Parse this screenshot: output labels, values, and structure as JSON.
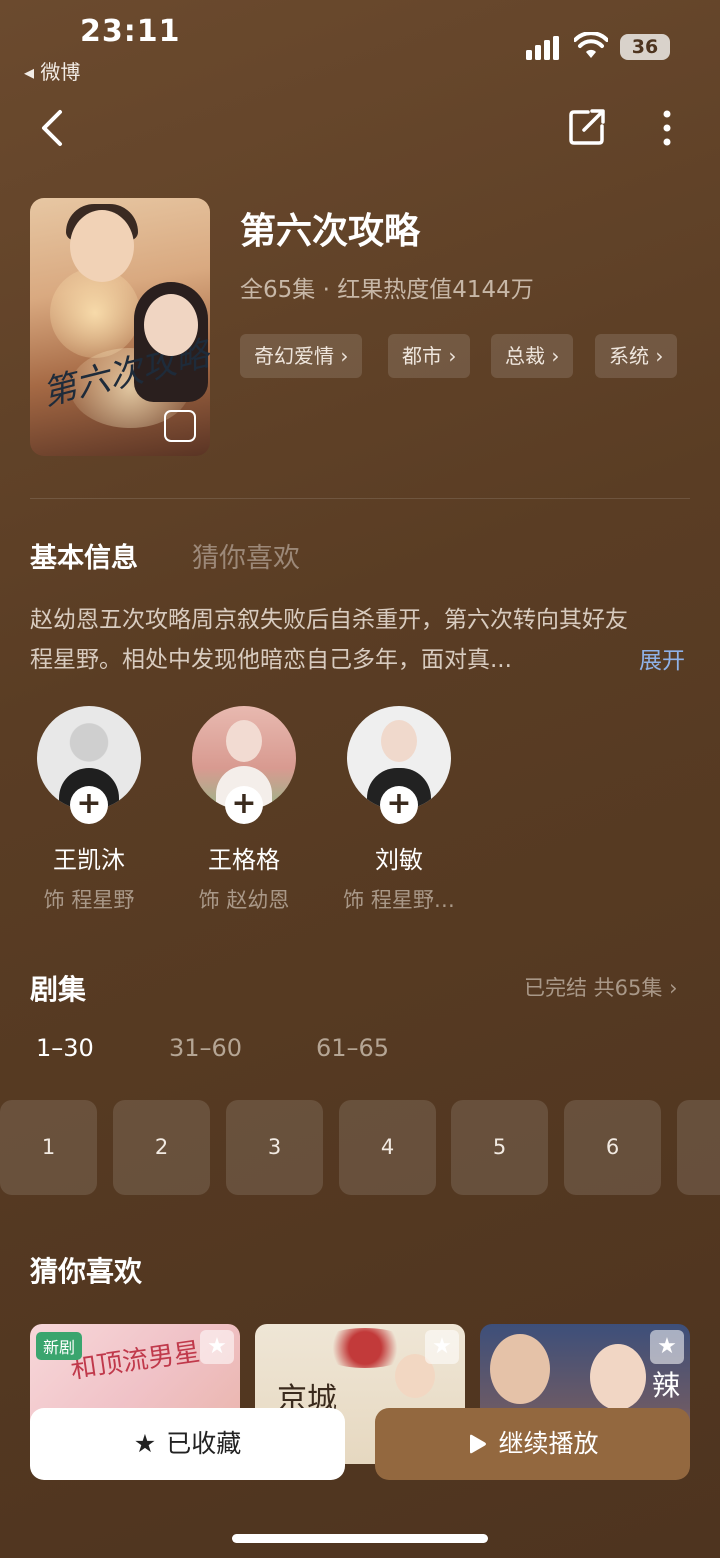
{
  "status": {
    "time": "23:11",
    "back_app": "◂ 微博",
    "battery": "36"
  },
  "show": {
    "title": "第六次攻略",
    "meta": "全65集 · 红果热度值4144万",
    "tags": [
      "奇幻爱情 ›",
      "都市 ›",
      "总裁 ›",
      "系统 ›"
    ],
    "poster_title_art": "第六次攻略"
  },
  "tabs": {
    "basic": "基本信息",
    "guess": "猜你喜欢"
  },
  "synopsis": {
    "text": "赵幼恩五次攻略周京叙失败后自杀重开，第六次转向其好友程星野。相处中发现他暗恋自己多年，面对真...",
    "expand": "展开"
  },
  "cast": [
    {
      "name": "王凯沐",
      "role": "饰 程星野"
    },
    {
      "name": "王格格",
      "role": "饰 赵幼恩"
    },
    {
      "name": "刘敏",
      "role": "饰 程星野…"
    }
  ],
  "episodes": {
    "title": "剧集",
    "status": "已完结 共65集 ›",
    "ranges": [
      "1–30",
      "31–60",
      "61–65"
    ],
    "items": [
      "1",
      "2",
      "3",
      "4",
      "5",
      "6"
    ]
  },
  "recommend": {
    "title": "猜你喜欢",
    "badge": "新剧",
    "card_art": [
      "和顶流男星",
      "京城",
      "辣"
    ]
  },
  "actions": {
    "favorite": "已收藏",
    "play": "继续播放"
  },
  "colors": {
    "accent": "#93683f",
    "background": "#5a3d24",
    "link": "#8fb2e8"
  }
}
